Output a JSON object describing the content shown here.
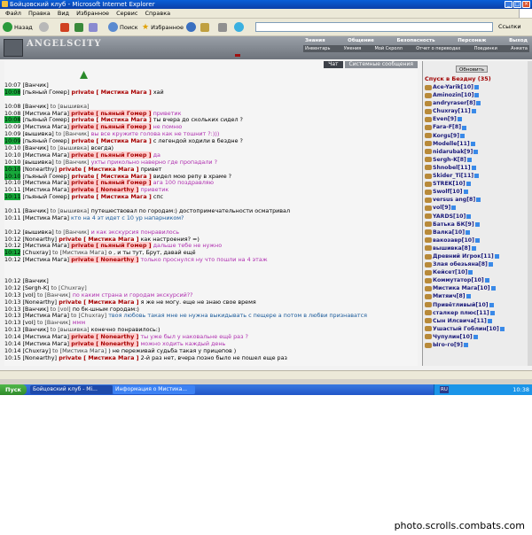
{
  "window": {
    "title": "Бойцовский клуб - Microsoft Internet Explorer"
  },
  "menu": [
    "Файл",
    "Правка",
    "Вид",
    "Избранное",
    "Сервис",
    "Справка"
  ],
  "toolbar": {
    "back": "Назад",
    "search": "Поиск",
    "favorites": "Избранное",
    "links": "Ссылки"
  },
  "site": {
    "logo": "ANGELSCITY",
    "nav_top": [
      "Знания",
      "Общение",
      "Безопасность",
      "Персонаж",
      "Выход"
    ],
    "nav_bottom": [
      "Инвентарь",
      "Умения",
      "Мой Скролл",
      "Отчет о переводах",
      "Поединки",
      "Анкета"
    ]
  },
  "chat": {
    "tabs": [
      "Чат",
      "Системные сообщения"
    ],
    "lines": [
      {
        "ts": "10:07",
        "hl": false,
        "nick": "[Ванчик]",
        "parts": [],
        "msg": "",
        "color": "k"
      },
      {
        "ts": "10:08",
        "hl": true,
        "nick": "[пьяный Гомер]",
        "parts": [
          {
            "t": "private [ Мистика Мага ]",
            "c": "priv"
          }
        ],
        "msg": " хай",
        "color": "k"
      },
      {
        "gap": true
      },
      {
        "ts": "10:08",
        "hl": false,
        "nick": "[Ванчик]",
        "parts": [
          {
            "t": " to [вышивка]",
            "c": "to"
          }
        ],
        "msg": "",
        "color": "k"
      },
      {
        "ts": "10:08",
        "hl": false,
        "nick": "[Мистика Мага]",
        "parts": [
          {
            "t": "private [ пьяный Гомер ]",
            "c": "privto"
          }
        ],
        "msg": " приветик",
        "color": "p"
      },
      {
        "ts": "10:08",
        "hl": true,
        "nick": "[пьяный Гомер]",
        "parts": [
          {
            "t": "private [ Мистика Мага ]",
            "c": "priv"
          }
        ],
        "msg": " ты вчера до скольких сидел ?",
        "color": "k"
      },
      {
        "ts": "10:09",
        "hl": false,
        "nick": "[Мистика Мага]",
        "parts": [
          {
            "t": "private [ пьяный Гомер ]",
            "c": "privto"
          }
        ],
        "msg": " не помню",
        "color": "p"
      },
      {
        "ts": "10:09",
        "hl": false,
        "nick": "[вышивка]",
        "parts": [
          {
            "t": " to [Ванчик]",
            "c": "to"
          }
        ],
        "msg": " вы все кружите голова как не тошнит ?:)))",
        "color": "p"
      },
      {
        "ts": "10:09",
        "hl": true,
        "nick": "[пьяный Гомер]",
        "parts": [
          {
            "t": "private [ Мистика Мага ]",
            "c": "priv"
          }
        ],
        "msg": " с легендой ходили в бездне ?",
        "color": "k"
      },
      {
        "ts": "10:10",
        "hl": false,
        "nick": "[Ванчик]",
        "parts": [
          {
            "t": " to [вышивка]",
            "c": "to"
          }
        ],
        "msg": " всегда)",
        "color": "k"
      },
      {
        "ts": "10:10",
        "hl": false,
        "nick": "[Мистика Мага]",
        "parts": [
          {
            "t": "private [ пьяный Гомер ]",
            "c": "privto"
          }
        ],
        "msg": " да",
        "color": "p"
      },
      {
        "ts": "10:10",
        "hl": false,
        "nick": "[вышивка]",
        "parts": [
          {
            "t": " to [Ванчик]",
            "c": "to"
          }
        ],
        "msg": " ухты прикольно наверно   где пропадали ?",
        "color": "p"
      },
      {
        "ts": "10:10",
        "hl": true,
        "nick": "[Nonearthy]",
        "parts": [
          {
            "t": "private [ Мистика Мага ]",
            "c": "priv"
          }
        ],
        "msg": " привет",
        "color": "k"
      },
      {
        "ts": "10:10",
        "hl": true,
        "nick": "[пьяный Гомер]",
        "parts": [
          {
            "t": "private [ Мистика Мага ]",
            "c": "priv"
          }
        ],
        "msg": " видел мою репу в храме ?",
        "color": "k"
      },
      {
        "ts": "10:10",
        "hl": false,
        "nick": "[Мистика Мага]",
        "parts": [
          {
            "t": "private [ пьяный Гомер ]",
            "c": "privto"
          }
        ],
        "msg": " ага 100 поздравляю",
        "color": "p"
      },
      {
        "ts": "10:11",
        "hl": false,
        "nick": "[Мистика Мага]",
        "parts": [
          {
            "t": "private [ Nonearthy ]",
            "c": "privto"
          }
        ],
        "msg": " приветик",
        "color": "p"
      },
      {
        "ts": "10:11",
        "hl": true,
        "nick": "[пьяный Гомер]",
        "parts": [
          {
            "t": "private [ Мистика Мага ]",
            "c": "priv"
          }
        ],
        "msg": " спс",
        "color": "k"
      },
      {
        "gap": true
      },
      {
        "ts": "10:11",
        "hl": false,
        "nick": "[Ванчик]",
        "parts": [
          {
            "t": " to [вышивка]",
            "c": "to"
          }
        ],
        "msg": " путешествовал по городам:) достопримечательности осматривал",
        "color": "k"
      },
      {
        "ts": "10:11",
        "hl": false,
        "nick": "[Мистика Мага]",
        "parts": [],
        "msg": " кто на 4 эт идет с 10 ур напарником?",
        "color": "b"
      },
      {
        "gap": true
      },
      {
        "ts": "10:12",
        "hl": false,
        "nick": "[вышивка]",
        "parts": [
          {
            "t": " to [Ванчик]",
            "c": "to"
          }
        ],
        "msg": " и как экскурсия понравилось",
        "color": "p"
      },
      {
        "ts": "10:12",
        "hl": false,
        "nick": "[Nonearthy]",
        "parts": [
          {
            "t": "private [ Мистика Мага ]",
            "c": "priv"
          }
        ],
        "msg": " как настроения? =)",
        "color": "k"
      },
      {
        "ts": "10:12",
        "hl": false,
        "nick": "[Мистика Мага]",
        "parts": [
          {
            "t": "private [ пьяный Гомер ]",
            "c": "privto"
          }
        ],
        "msg": " дальше тебе не нужно",
        "color": "p"
      },
      {
        "ts": "10:12",
        "hl": true,
        "nick": "[Chuxray]",
        "parts": [
          {
            "t": " to [Мистика Мага]",
            "c": "to"
          }
        ],
        "msg": " о , и ты тут, Брут, давай ещё",
        "color": "k"
      },
      {
        "ts": "10:12",
        "hl": false,
        "nick": "[Мистика Мага]",
        "parts": [
          {
            "t": "private [ Nonearthy ]",
            "c": "privto"
          }
        ],
        "msg": " только проснулся ну что пошли на 4 этаж",
        "color": "p"
      },
      {
        "gap": true
      },
      {
        "gap": true
      },
      {
        "ts": "10:12",
        "hl": false,
        "nick": "[Ванчик]",
        "parts": [],
        "msg": "",
        "color": "k"
      },
      {
        "ts": "10:12",
        "hl": false,
        "nick": "[Sergh-K]",
        "parts": [
          {
            "t": " to [Chuxray]",
            "c": "to"
          }
        ],
        "msg": "",
        "color": "k"
      },
      {
        "ts": "10:13",
        "hl": false,
        "nick": "[vol]",
        "parts": [
          {
            "t": " to [Ванчик]",
            "c": "to"
          }
        ],
        "msg": " по каким страна и городам экскурсий??",
        "color": "p"
      },
      {
        "ts": "10:13",
        "hl": false,
        "nick": "[Nonearthy]",
        "parts": [
          {
            "t": "private [ Мистика Мага ]",
            "c": "priv"
          }
        ],
        "msg": " я же не могу. еще не знаю свое время",
        "color": "k"
      },
      {
        "ts": "10:13",
        "hl": false,
        "nick": "[Ванчик]",
        "parts": [
          {
            "t": " to [vol]",
            "c": "to"
          }
        ],
        "msg": "   по бк-шным городам:)",
        "color": "k"
      },
      {
        "ts": "10:13",
        "hl": false,
        "nick": "[Мистика Мага]",
        "parts": [
          {
            "t": " to [Chuxray]",
            "c": "to"
          }
        ],
        "msg": " твоя любовь такая мне не нужна выкидывать с пещере а потом в любви признаватся",
        "color": "b"
      },
      {
        "ts": "10:13",
        "hl": false,
        "nick": "[vol]",
        "parts": [
          {
            "t": " to [Ванчик]",
            "c": "to"
          }
        ],
        "msg": " ммм",
        "color": "p"
      },
      {
        "ts": "10:13",
        "hl": false,
        "nick": "[Ванчик]",
        "parts": [
          {
            "t": " to [вышивка]",
            "c": "to"
          }
        ],
        "msg": " конечно понравилось:)",
        "color": "k"
      },
      {
        "ts": "10:14",
        "hl": false,
        "nick": "[Мистика Мага]",
        "parts": [
          {
            "t": "private [ Nonearthy ]",
            "c": "privto"
          }
        ],
        "msg": " ты уже был у наковальне ещё раз ?",
        "color": "p"
      },
      {
        "ts": "10:14",
        "hl": false,
        "nick": "[Мистика Мага]",
        "parts": [
          {
            "t": "private [ Nonearthy ]",
            "c": "privto"
          }
        ],
        "msg": " можно ходить каждый день",
        "color": "p"
      },
      {
        "ts": "10:14",
        "hl": false,
        "nick": "[Chuxray]",
        "parts": [
          {
            "t": " to [Мистика Мага]",
            "c": "to"
          }
        ],
        "msg": " ) не переживай судьба такая у прицепов )",
        "color": "k"
      },
      {
        "ts": "10:15",
        "hl": false,
        "nick": "[Nonearthy]",
        "parts": [
          {
            "t": "private [ Мистика Мага ]",
            "c": "priv"
          }
        ],
        "msg": " 2-й раз нет, вчера позно было не пошел еще раз",
        "color": "k"
      }
    ]
  },
  "side": {
    "refresh": "Обновить",
    "location": "Спуск в Бездну (35)",
    "users": [
      "Ace-Yarik[10]",
      "Aminozin[10]",
      "andryraser[8]",
      "Chuxray[11]",
      "Even[9]",
      "Fara-F[8]",
      "Korgs[9]",
      "Modelle[11]",
      "nidarubak[9]",
      "Sergh-K[8]",
      "Shnobel[11]",
      "Skider_Ti[11]",
      "STREK[10]",
      "Swolf[10]",
      "versus ang[8]",
      "vol[9]",
      "YARDS[10]",
      "Батька БК[9]",
      "Валка[10]",
      "вакозавр[10]",
      "вышивка[8]",
      "Древний Игрок[11]",
      "Злая обезьяна[8]",
      "Кейсет[10]",
      "Коммутатор[10]",
      "Мистика Мага[10]",
      "Митяич[8]",
      "Привётливый[10]",
      "сталкер плюс[11]",
      "Сын Илсвича[11]",
      "Ушастый Гоблин[10]",
      "Чупулин[10]",
      "Ыго-го[9]"
    ]
  },
  "taskbar": {
    "start": "Пуск",
    "tasks": [
      "Бойцовский клуб - Mi...",
      "Информация о Мистика..."
    ],
    "lang": "RU",
    "clock": "10:38"
  },
  "watermark": "photo.scrolls.combats.com"
}
